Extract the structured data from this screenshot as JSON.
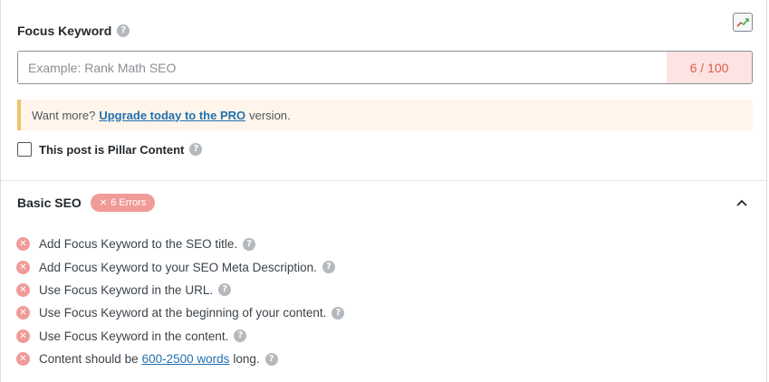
{
  "focus_keyword": {
    "label": "Focus Keyword",
    "placeholder": "Example: Rank Math SEO",
    "value": "",
    "count": "6 / 100"
  },
  "notice": {
    "prefix": "Want more?",
    "link": "Upgrade today to the PRO",
    "suffix": "version."
  },
  "pillar": {
    "label": "This post is Pillar Content",
    "checked": false
  },
  "basic_seo": {
    "title": "Basic SEO",
    "badge": "6 Errors",
    "badge_icon": "x-icon",
    "collapse_icon": "chevron-up-icon",
    "checks": [
      {
        "text": "Add Focus Keyword to the SEO title."
      },
      {
        "text": "Add Focus Keyword to your SEO Meta Description."
      },
      {
        "text": "Use Focus Keyword in the URL."
      },
      {
        "text": "Use Focus Keyword at the beginning of your content."
      },
      {
        "text": "Use Focus Keyword in the content."
      },
      {
        "prefix": "Content should be",
        "link": "600-2500 words",
        "suffix": "long."
      }
    ]
  },
  "colors": {
    "error": "#f09b98",
    "count_bg": "#fde3e1",
    "count_text": "#e05b4a",
    "notice_bg": "#fff5ea",
    "notice_border": "#f0c36a",
    "link": "#2271b1"
  },
  "icons": {
    "trends": "trending-chart-icon",
    "help": "question-mark-icon",
    "error": "x-circle-icon"
  }
}
